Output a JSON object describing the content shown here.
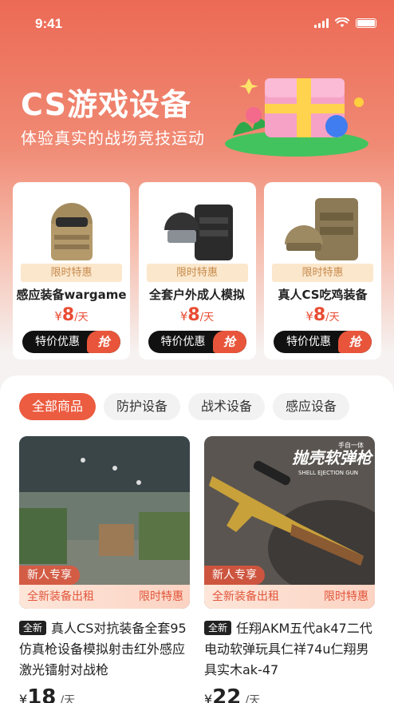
{
  "status": {
    "time": "9:41"
  },
  "hero": {
    "title": "CS游戏设备",
    "subtitle": "体验真实的战场竞技运动"
  },
  "deals": [
    {
      "badge": "限时特惠",
      "name": "感应装备wargame",
      "currency": "¥",
      "price": "8",
      "unit": "/天",
      "buy_label": "特价优惠",
      "grab_label": "抢"
    },
    {
      "badge": "限时特惠",
      "name": "全套户外成人模拟",
      "currency": "¥",
      "price": "8",
      "unit": "/天",
      "buy_label": "特价优惠",
      "grab_label": "抢"
    },
    {
      "badge": "限时特惠",
      "name": "真人CS吃鸡装备",
      "currency": "¥",
      "price": "8",
      "unit": "/天",
      "buy_label": "特价优惠",
      "grab_label": "抢"
    }
  ],
  "tabs": [
    {
      "label": "全部商品",
      "active": true
    },
    {
      "label": "防护设备",
      "active": false
    },
    {
      "label": "战术设备",
      "active": false
    },
    {
      "label": "感应设备",
      "active": false
    }
  ],
  "products": [
    {
      "tag": "新人专享",
      "strip_left": "全新装备出租",
      "strip_right": "限时特惠",
      "new_badge": "全新",
      "title": "真人CS对抗装备全套95仿真枪设备模拟射击红外感应激光镭射对战枪",
      "currency": "¥",
      "price": "18",
      "unit": "/天"
    },
    {
      "tag": "新人专享",
      "strip_left": "全新装备出租",
      "strip_right": "限时特惠",
      "new_badge": "全新",
      "title": "任翔AKM五代ak47二代电动软弹玩具仁祥74u仁翔男具实木ak-47",
      "currency": "¥",
      "price": "22",
      "unit": "/天",
      "image_caption": "抛壳软弹枪",
      "image_caption_small": "SHELL EJECTION GUN",
      "image_caption_top": "手自一体"
    }
  ],
  "colors": {
    "accent": "#ec5c40",
    "price": "#e84c32"
  }
}
